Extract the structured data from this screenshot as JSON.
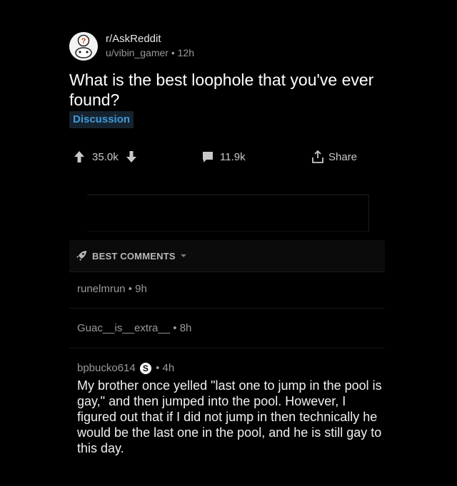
{
  "post": {
    "subreddit": "r/AskReddit",
    "author": "u/vibin_gamer",
    "separator": "•",
    "age": "12h",
    "title": "What is the best loophole that you've ever found?",
    "flair": "Discussion",
    "flair_color": "#3d9ad9",
    "score": "35.0k",
    "comment_count": "11.9k",
    "share_label": "Share"
  },
  "sort": {
    "label": "BEST COMMENTS",
    "icon": "rocket-icon"
  },
  "comments": [
    {
      "author": "runelmrun",
      "separator": "•",
      "age": "9h"
    },
    {
      "author": "Guac__is__extra__",
      "separator": "•",
      "age": "8h"
    },
    {
      "author": "bpbucko614",
      "badge": "S",
      "separator": "•",
      "age": "4h",
      "body": "My brother once yelled \"last one to jump in the pool is gay,\" and then jumped into the pool. However, I figured out that if I did not jump in then technically he would be the last one in the pool, and he is still gay to this day."
    }
  ]
}
